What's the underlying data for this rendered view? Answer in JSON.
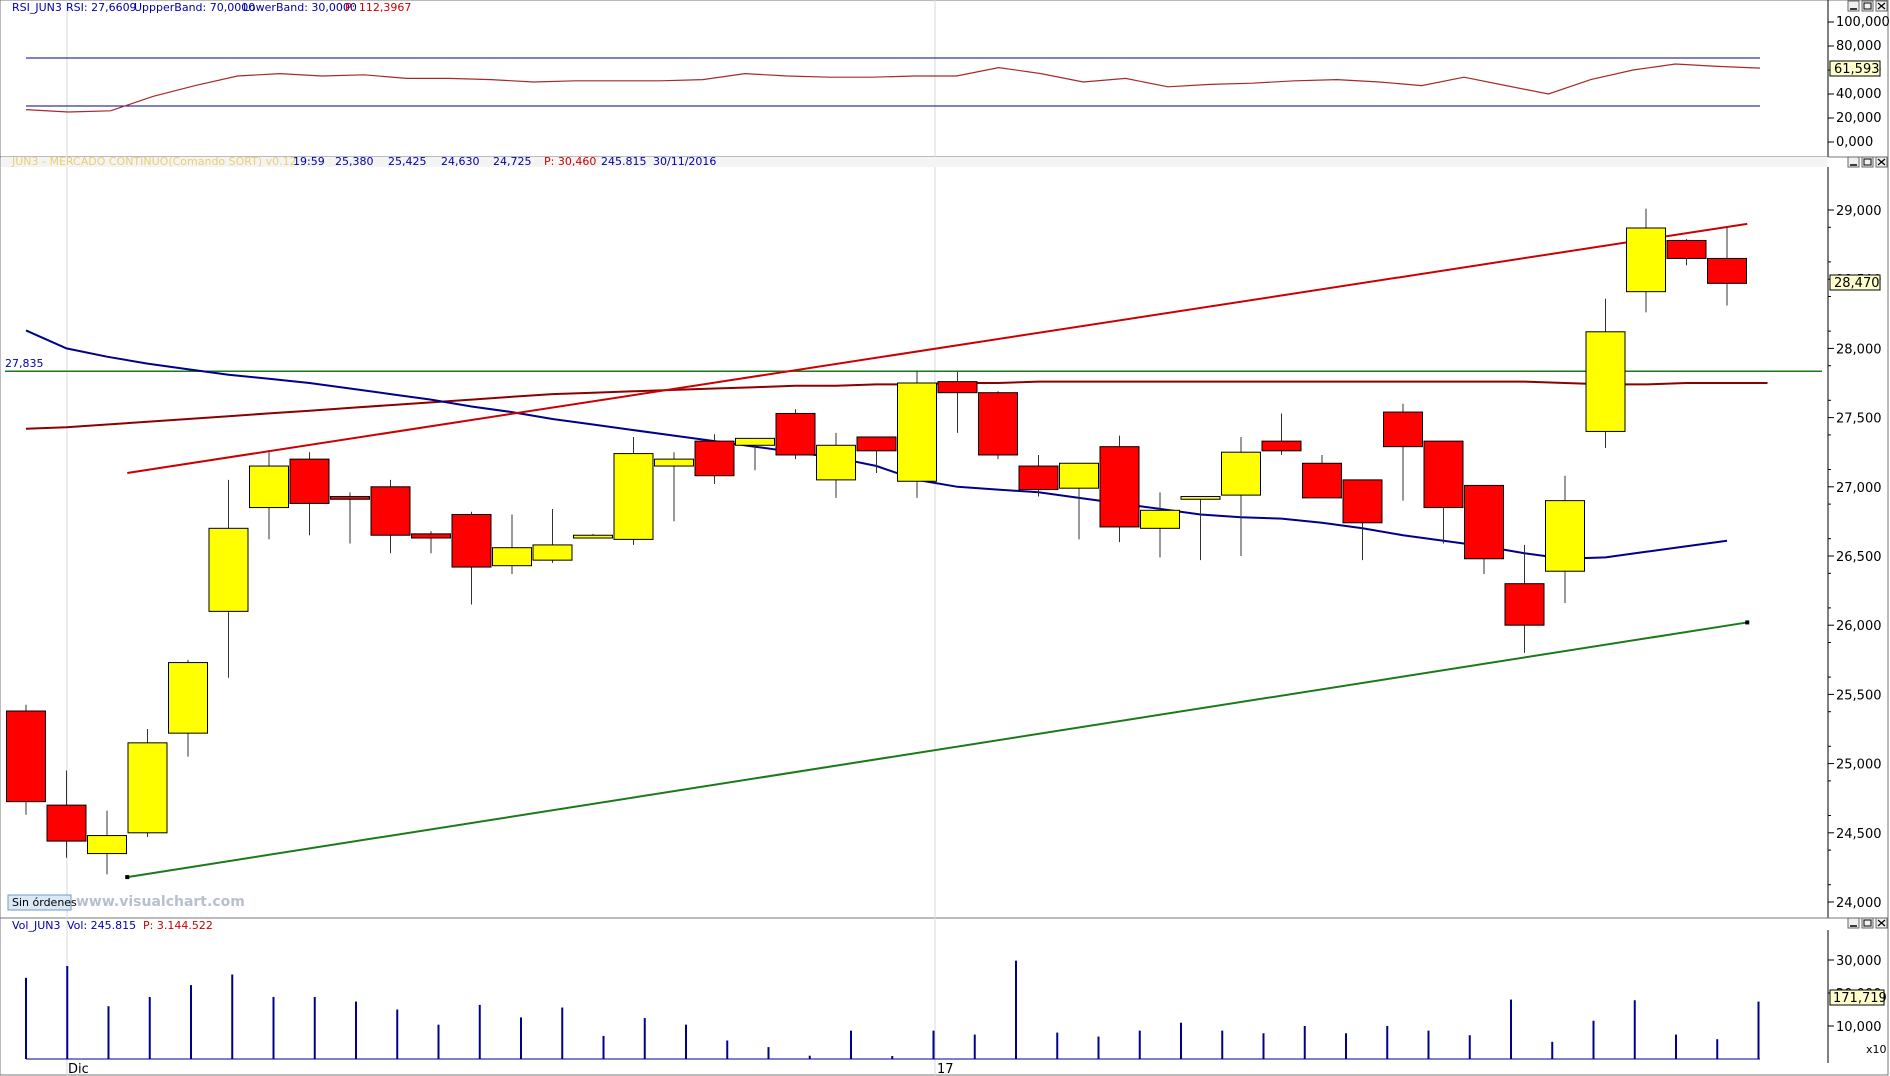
{
  "colors": {
    "up_body": "#ffff00",
    "down_body": "#ff0000",
    "rsi_line": "#a52a2a",
    "rsi_bands": "#00008b",
    "resistance_trend": "#cc0000",
    "support_trend": "#1a7a1a",
    "horizontal_level": "#1a7a1a",
    "slow_ma": "#8b0000",
    "fast_ma": "#00008b",
    "volume_bar": "#00008b"
  },
  "rsi_panel": {
    "header": {
      "name": "RSI_JUN3",
      "rsi_label": "RSI: 27,6609",
      "upper_label": "UppperBand: 70,0000",
      "lower_label": "LowerBand: 30,0000",
      "p_label": "P: 112,3967"
    },
    "current_value_box": "61,593"
  },
  "price_panel": {
    "header": {
      "name": "JUN3 - MERCADO CONTINUO(Comando SORT) v0.12",
      "time": "19:59",
      "open": "25,380",
      "high": "25,425",
      "low": "24,630",
      "close": "24,725",
      "p_label": "P: 30,460",
      "volume": "245.815",
      "date": "30/11/2016"
    },
    "current_value_box": "28,470",
    "level_label": "27,835",
    "orders_button": "Sin órdenes",
    "watermark": "www.visualchart.com"
  },
  "volume_panel": {
    "header": {
      "name": "Vol_JUN3",
      "vol_label": "Vol: 245.815",
      "p_label": "P: 3.144.522"
    },
    "current_value_box": "171,719",
    "scale_note": "x10"
  },
  "x_labels": [
    "Dic",
    "17"
  ],
  "chart_data": [
    {
      "type": "line",
      "name": "RSI",
      "ylim": [
        0,
        100
      ],
      "yticks": [
        "100,000",
        "80,000",
        "60,000",
        "40,000",
        "20,000",
        "0,000"
      ],
      "upper_band": 70,
      "lower_band": 30,
      "values": [
        27,
        25,
        26,
        38,
        47,
        55,
        57,
        55,
        56,
        53,
        53,
        52,
        50,
        51,
        51,
        51,
        52,
        57,
        55,
        54,
        54,
        55,
        55,
        62,
        57,
        50,
        53,
        46,
        48,
        49,
        51,
        52,
        50,
        47,
        54,
        47,
        40,
        52,
        60,
        65,
        63,
        61.6
      ],
      "current_value": 61.593
    },
    {
      "type": "candlestick",
      "name": "JUN3",
      "ylim": [
        23.9,
        29.3
      ],
      "yticks": [
        "29,000",
        "28,500",
        "28,000",
        "27,500",
        "27,000",
        "26,500",
        "26,000",
        "25,500",
        "25,000",
        "24,500",
        "24,000"
      ],
      "candles": [
        {
          "o": 25.38,
          "h": 25.425,
          "l": 24.63,
          "c": 24.725
        },
        {
          "o": 24.7,
          "h": 24.95,
          "l": 24.32,
          "c": 24.44
        },
        {
          "o": 24.35,
          "h": 24.66,
          "l": 24.2,
          "c": 24.48
        },
        {
          "o": 24.5,
          "h": 25.25,
          "l": 24.47,
          "c": 25.15
        },
        {
          "o": 25.22,
          "h": 25.75,
          "l": 25.05,
          "c": 25.73
        },
        {
          "o": 26.1,
          "h": 27.05,
          "l": 25.62,
          "c": 26.7
        },
        {
          "o": 26.85,
          "h": 27.25,
          "l": 26.62,
          "c": 27.15
        },
        {
          "o": 27.2,
          "h": 27.25,
          "l": 26.65,
          "c": 26.88
        },
        {
          "o": 26.93,
          "h": 26.96,
          "l": 26.59,
          "c": 26.91
        },
        {
          "o": 27.0,
          "h": 27.05,
          "l": 26.52,
          "c": 26.65
        },
        {
          "o": 26.66,
          "h": 26.68,
          "l": 26.52,
          "c": 26.63
        },
        {
          "o": 26.8,
          "h": 26.82,
          "l": 26.15,
          "c": 26.42
        },
        {
          "o": 26.43,
          "h": 26.8,
          "l": 26.37,
          "c": 26.56
        },
        {
          "o": 26.47,
          "h": 26.84,
          "l": 26.45,
          "c": 26.58
        },
        {
          "o": 26.63,
          "h": 26.66,
          "l": 26.63,
          "c": 26.65
        },
        {
          "o": 26.62,
          "h": 27.36,
          "l": 26.58,
          "c": 27.24
        },
        {
          "o": 27.15,
          "h": 27.25,
          "l": 26.75,
          "c": 27.2
        },
        {
          "o": 27.33,
          "h": 27.38,
          "l": 27.02,
          "c": 27.08
        },
        {
          "o": 27.3,
          "h": 27.35,
          "l": 27.12,
          "c": 27.35
        },
        {
          "o": 27.53,
          "h": 27.56,
          "l": 27.2,
          "c": 27.23
        },
        {
          "o": 27.05,
          "h": 27.39,
          "l": 26.92,
          "c": 27.3
        },
        {
          "o": 27.36,
          "h": 27.36,
          "l": 27.1,
          "c": 27.26
        },
        {
          "o": 27.04,
          "h": 27.84,
          "l": 26.92,
          "c": 27.75
        },
        {
          "o": 27.76,
          "h": 27.83,
          "l": 27.39,
          "c": 27.68
        },
        {
          "o": 27.68,
          "h": 27.69,
          "l": 27.2,
          "c": 27.23
        },
        {
          "o": 27.15,
          "h": 27.23,
          "l": 26.93,
          "c": 26.98
        },
        {
          "o": 26.99,
          "h": 27.17,
          "l": 26.62,
          "c": 27.17
        },
        {
          "o": 27.29,
          "h": 27.37,
          "l": 26.6,
          "c": 26.71
        },
        {
          "o": 26.7,
          "h": 26.96,
          "l": 26.49,
          "c": 26.83
        },
        {
          "o": 26.91,
          "h": 26.93,
          "l": 26.47,
          "c": 26.93
        },
        {
          "o": 26.94,
          "h": 27.36,
          "l": 26.5,
          "c": 27.25
        },
        {
          "o": 27.33,
          "h": 27.53,
          "l": 27.23,
          "c": 27.26
        },
        {
          "o": 27.17,
          "h": 27.23,
          "l": 26.92,
          "c": 26.92
        },
        {
          "o": 27.05,
          "h": 27.05,
          "l": 26.47,
          "c": 26.74
        },
        {
          "o": 27.54,
          "h": 27.6,
          "l": 26.9,
          "c": 27.29
        },
        {
          "o": 27.33,
          "h": 27.33,
          "l": 26.59,
          "c": 26.85
        },
        {
          "o": 27.01,
          "h": 27.01,
          "l": 26.37,
          "c": 26.48
        },
        {
          "o": 26.3,
          "h": 26.58,
          "l": 25.8,
          "c": 26.0
        },
        {
          "o": 26.39,
          "h": 27.08,
          "l": 26.16,
          "c": 26.9
        },
        {
          "o": 27.4,
          "h": 28.36,
          "l": 27.28,
          "c": 28.12
        },
        {
          "o": 28.41,
          "h": 29.01,
          "l": 28.26,
          "c": 28.87
        },
        {
          "o": 28.78,
          "h": 28.79,
          "l": 28.6,
          "c": 28.65
        },
        {
          "o": 28.65,
          "h": 28.88,
          "l": 28.31,
          "c": 28.47
        }
      ],
      "horizontal_level": 27.835,
      "resistance_line": {
        "from": {
          "bar": 2.5,
          "y": 27.1
        },
        "to": {
          "bar": 42.5,
          "y": 28.9
        }
      },
      "support_line": {
        "from": {
          "bar": 2.5,
          "y": 24.18
        },
        "to": {
          "bar": 42.5,
          "y": 26.02
        }
      },
      "slow_ma": [
        27.42,
        27.43,
        27.45,
        27.47,
        27.49,
        27.51,
        27.53,
        27.55,
        27.57,
        27.59,
        27.61,
        27.63,
        27.65,
        27.67,
        27.68,
        27.69,
        27.7,
        27.71,
        27.72,
        27.73,
        27.73,
        27.74,
        27.74,
        27.75,
        27.75,
        27.76,
        27.76,
        27.76,
        27.76,
        27.76,
        27.76,
        27.76,
        27.76,
        27.76,
        27.76,
        27.76,
        27.76,
        27.76,
        27.75,
        27.74,
        27.74,
        27.75,
        27.75,
        27.75
      ],
      "fast_ma": [
        28.13,
        28.0,
        27.94,
        27.89,
        27.85,
        27.81,
        27.78,
        27.75,
        27.71,
        27.67,
        27.63,
        27.58,
        27.54,
        27.49,
        27.45,
        27.41,
        27.37,
        27.33,
        27.29,
        27.25,
        27.21,
        27.15,
        27.05,
        27.0,
        26.98,
        26.96,
        26.92,
        26.88,
        26.84,
        26.8,
        26.78,
        26.77,
        26.74,
        26.7,
        26.65,
        26.61,
        26.57,
        26.52,
        26.48,
        26.49,
        26.53,
        26.57,
        26.61
      ]
    },
    {
      "type": "bar",
      "name": "Vol_JUN3",
      "ylim": [
        0,
        36
      ],
      "yticks": [
        "30,000",
        "20,000",
        "10,000"
      ],
      "unit_multiplier": "x10",
      "values": [
        24.6,
        28.2,
        16.0,
        18.8,
        22.4,
        25.6,
        18.8,
        18.8,
        17.4,
        15.0,
        10.4,
        16.4,
        12.6,
        15.6,
        7.0,
        12.4,
        10.4,
        5.6,
        3.6,
        1.0,
        8.6,
        0.9,
        8.6,
        7.4,
        29.8,
        8.0,
        6.8,
        8.6,
        11.0,
        8.6,
        7.8,
        10.0,
        7.8,
        10.0,
        8.6,
        7.2,
        18.0,
        5.2,
        11.6,
        17.8,
        7.4,
        6.0,
        17.4
      ]
    }
  ]
}
